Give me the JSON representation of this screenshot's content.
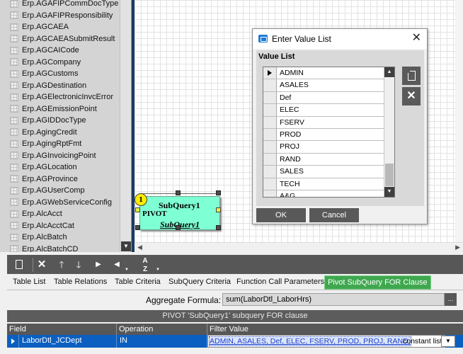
{
  "table_list": {
    "items": [
      "Erp.AGAFIPCommDocType",
      "Erp.AGAFIPResponsibility",
      "Erp.AGCAEA",
      "Erp.AGCAEASubmitResult",
      "Erp.AGCAICode",
      "Erp.AGCompany",
      "Erp.AGCustoms",
      "Erp.AGDestination",
      "Erp.AGElectronicInvcError",
      "Erp.AGEmissionPoint",
      "Erp.AGIDDocType",
      "Erp.AgingCredit",
      "Erp.AgingRptFmt",
      "Erp.AGInvoicingPoint",
      "Erp.AGLocation",
      "Erp.AGProvince",
      "Erp.AGUserComp",
      "Erp.AGWebServiceConfig",
      "Erp.AlcAcct",
      "Erp.AlcAcctCat",
      "Erp.AlcBatch",
      "Erp.AlcBatchCD"
    ]
  },
  "subquery_node": {
    "badge": "1",
    "title": "SubQuery1",
    "type": "PIVOT",
    "name": "SubQuery1"
  },
  "dialog": {
    "title": "Enter Value List",
    "group_label": "Value List",
    "values": [
      "ADMIN",
      "ASALES",
      "Def",
      "ELEC",
      "FSERV",
      "PROD",
      "PROJ",
      "RAND",
      "SALES",
      "TECH",
      "A&G"
    ],
    "ok_label": "OK",
    "cancel_label": "Cancel",
    "new_icon": "new-document-icon",
    "delete_icon": "delete-x-icon",
    "close_glyph": "✕"
  },
  "toolbar": {
    "icons": [
      "new-document-icon",
      "delete-icon",
      "move-up-icon",
      "move-down-icon",
      "move-right-icon",
      "move-left-icon",
      "sort-az-icon"
    ]
  },
  "tabs": [
    "Table List",
    "Table Relations",
    "Table Criteria",
    "SubQuery Criteria",
    "Function Call Parameters",
    "Pivot SubQuery FOR Clause"
  ],
  "active_tab": "Pivot SubQuery FOR Clause",
  "aggregate": {
    "label": "Aggregate Formula:",
    "value": "sum(LaborDtl_LaborHrs)",
    "browse_label": "..."
  },
  "pivot_grid": {
    "header": "PIVOT 'SubQuery1' subquery FOR clause",
    "columns": [
      "Field",
      "Operation",
      "Filter Value"
    ],
    "row": {
      "field": "LaborDtl_JCDept",
      "operation": "IN",
      "filter_value": "ADMIN, ASALES, Def, ELEC, FSERV, PROD, PROJ, RAND,",
      "filter_suffix": "constant list"
    }
  },
  "colors": {
    "splitter": "#1c3d63",
    "node_fill": "#7fffd4",
    "active_tab": "#3fa84f",
    "selected_row": "#0b5fc0",
    "toolbar": "#575757"
  }
}
